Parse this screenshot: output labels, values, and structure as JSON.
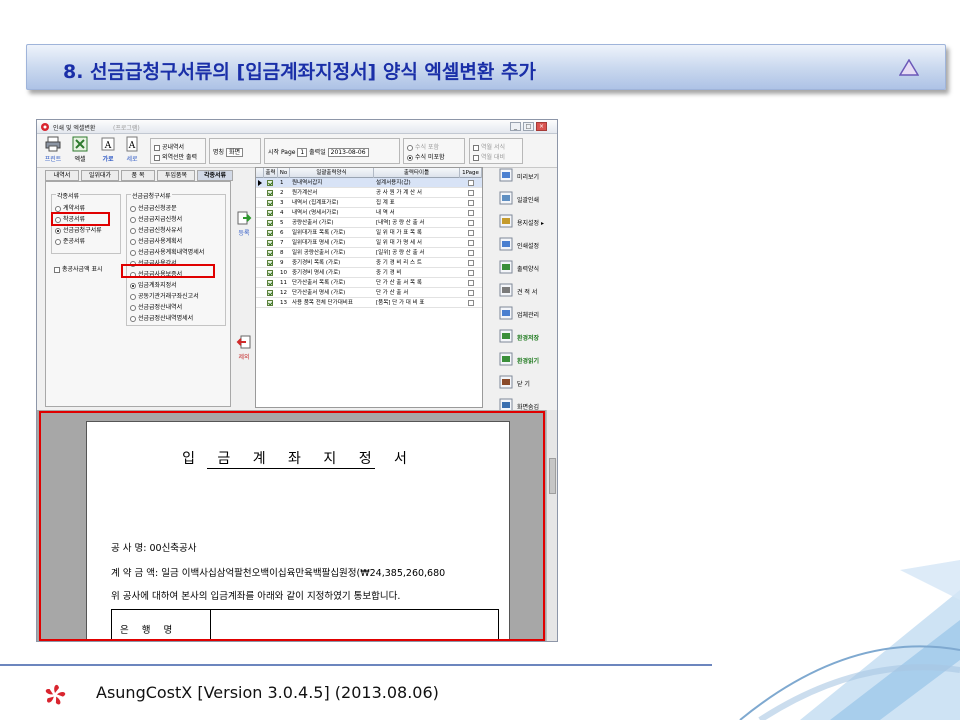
{
  "slide": {
    "title": "8. 선금급청구서류의 [입금계좌지정서] 양식 엑셀변환 추가"
  },
  "window": {
    "title": "인쇄 및 엑셀변환",
    "subtitle": "(프로그램)",
    "minimize": "_",
    "maximize": "□",
    "close": "×"
  },
  "toolbar": {
    "print_label": "프린트",
    "excel_label": "엑셀",
    "landscape_label": "가로",
    "portrait_label": "세로",
    "options": [
      "공내역서",
      "외역선만 출력"
    ],
    "unit_label": "명칭",
    "unit_value": "화면",
    "start_page_label": "시작 Page",
    "start_page_value": "1",
    "print_date_label": "출력일",
    "print_date_value": "2013-08-06",
    "amount_opts": [
      "수식 포함",
      "수식 미포함"
    ],
    "extra_opts": [
      "역월 서식",
      "역월 대비"
    ]
  },
  "tabs": [
    "내역서",
    "일위대가",
    "품 목",
    "투입품목",
    "각종서류"
  ],
  "left_panel": {
    "group1_title": "각종서류",
    "group1_items": [
      "계약서류",
      "착공서류",
      "선금급청구서류",
      "준공서류"
    ],
    "group1_selected": 2,
    "total_label": "총공사금액 표시",
    "group2_title": "선금급청구서류",
    "group2_items": [
      "선금급신청공문",
      "선금급지급신청서",
      "선금급신청사유서",
      "선금급사용계획서",
      "선금급사용계획내역명세서",
      "선금급사용각서",
      "선금급사용보증서",
      "입금계좌지정서",
      "공동기관거래구좌신고서",
      "선금급정산내역서",
      "선금급정산내역명세서"
    ],
    "group2_selected": 7
  },
  "register_label": "등록",
  "remove_label": "제외",
  "grid": {
    "headers": [
      "출력",
      "No",
      "일괄출력양식",
      "출력타이틀",
      "1Page"
    ],
    "rows": [
      {
        "no": "1",
        "form": "원내역서갑지",
        "title": "설계서용지(갑)"
      },
      {
        "no": "2",
        "form": "원가계산서",
        "title": "공 사 원 가 계 산 서"
      },
      {
        "no": "3",
        "form": "내역서 (집계표가로)",
        "title": "집       계       표"
      },
      {
        "no": "4",
        "form": "내역서 (명세서가로)",
        "title": "내       역       서"
      },
      {
        "no": "5",
        "form": "공량산출서 (가로)",
        "title": "[내역] 공 량 산 출 서"
      },
      {
        "no": "6",
        "form": "일위대가표 목록 (가로)",
        "title": "일 위 대 가 표 목 록"
      },
      {
        "no": "7",
        "form": "일위대가표 명세 (가로)",
        "title": "일 위 대 가 명 세 서"
      },
      {
        "no": "8",
        "form": "일위 공량산출서 (가로)",
        "title": "[일위] 공 량 산 출 서"
      },
      {
        "no": "9",
        "form": "중기경비 목록 (가로)",
        "title": "중 기 경 비 리 스 트"
      },
      {
        "no": "10",
        "form": "중기경비 명세 (가로)",
        "title": "중    기    경    비"
      },
      {
        "no": "11",
        "form": "단가산출서 목록 (가로)",
        "title": "단 가 산 출 서 목 록"
      },
      {
        "no": "12",
        "form": "단가산출서 명세 (가로)",
        "title": "단    가    산    출    서"
      },
      {
        "no": "13",
        "form": "사용 품목 전체 단가대비표",
        "title": "[품목] 단 가 대 비 표"
      }
    ]
  },
  "side_buttons": [
    {
      "label": "미리보기",
      "icon": "preview-icon",
      "green": false
    },
    {
      "label": "일괄인쇄",
      "icon": "batch-print-icon",
      "green": false
    },
    {
      "label": "용지설정 ▸",
      "icon": "paper-setup-icon",
      "green": false
    },
    {
      "label": "인쇄설정",
      "icon": "print-setup-icon",
      "green": false
    },
    {
      "label": "출력양식",
      "icon": "print-form-icon",
      "green": false
    },
    {
      "label": "견 적 서",
      "icon": "estimate-icon",
      "green": false
    },
    {
      "label": "업체관리",
      "icon": "company-icon",
      "green": false
    },
    {
      "label": "환경저장",
      "icon": "save-settings-icon",
      "green": true
    },
    {
      "label": "환경읽기",
      "icon": "load-settings-icon",
      "green": true
    },
    {
      "label": "닫    기",
      "icon": "close-door-icon",
      "green": false
    },
    {
      "label": "화면숨김",
      "icon": "hide-screen-icon",
      "green": false
    }
  ],
  "preview": {
    "title": "입 금 계 좌 지 정 서",
    "line1": "공    사    명: 00신축공사",
    "line2": "계  약  금  액: 일금 이백사십삼억팔천오백이십육만육백팔십원정(₩24,385,260,680",
    "line3": "위 공사에 대하여 본사의 입금계좌를 아래와 같이 지정하였기 통보합니다.",
    "bank_label": "은 행 명"
  },
  "footer": {
    "text": "AsungCostX    [Version 3.0.4.5]     (2013.08.06)"
  },
  "colors": {
    "title_text": "#1a2fa8",
    "highlight": "#e00000",
    "accent_green": "#1f7a1f"
  }
}
